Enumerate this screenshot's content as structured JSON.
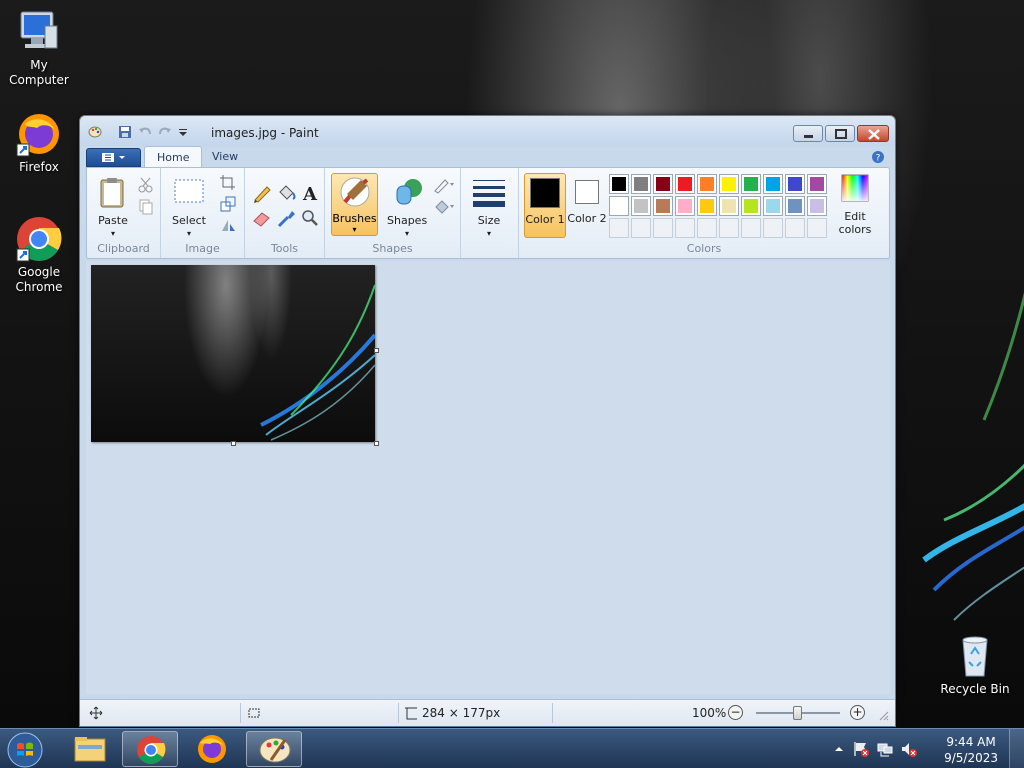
{
  "desktop": {
    "icons": [
      {
        "label": "My Computer"
      },
      {
        "label": "Firefox"
      },
      {
        "label": "Google Chrome"
      },
      {
        "label": "Recycle Bin"
      }
    ]
  },
  "window": {
    "title": "images.jpg - Paint"
  },
  "ribbon": {
    "tabs": [
      {
        "label": "Home"
      },
      {
        "label": "View"
      }
    ],
    "groups": {
      "clipboard": {
        "label": "Clipboard",
        "paste": "Paste"
      },
      "image": {
        "label": "Image",
        "select": "Select"
      },
      "tools": {
        "label": "Tools"
      },
      "shapes": {
        "label": "Shapes",
        "brushes": "Brushes",
        "shapes_btn": "Shapes"
      },
      "size": {
        "label": "Size"
      },
      "colors": {
        "label": "Colors",
        "color1": "Color 1",
        "color2": "Color 2",
        "edit_colors": "Edit colors",
        "color1_value": "#000000",
        "color2_value": "#ffffff",
        "palette_row1": [
          "#000000",
          "#7f7f7f",
          "#880015",
          "#ed1c24",
          "#ff7f27",
          "#fff200",
          "#22b14c",
          "#00a2e8",
          "#3f48cc",
          "#a349a4"
        ],
        "palette_row2": [
          "#ffffff",
          "#c3c3c3",
          "#b97a57",
          "#ffaec9",
          "#ffc90e",
          "#efe4b0",
          "#b5e61d",
          "#99d9ea",
          "#7092be",
          "#c8bfe7"
        ]
      }
    }
  },
  "statusbar": {
    "dimensions": "284 × 177px",
    "zoom": "100%",
    "zoom_level": 0.5
  },
  "taskbar": {
    "time": "9:44 AM",
    "date": "9/5/2023"
  }
}
